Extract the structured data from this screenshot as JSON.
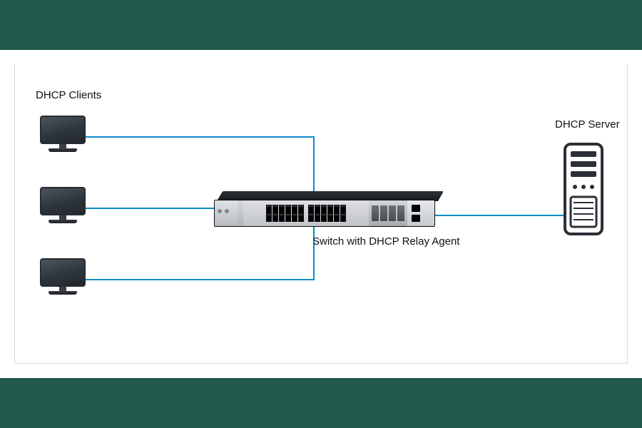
{
  "labels": {
    "clients": "DHCP Clients",
    "switch": "Switch with DHCP Relay Agent",
    "server": "DHCP Server"
  },
  "colors": {
    "band": "#1f5a4d",
    "wire": "#0b8cc6",
    "border": "#d7dadd"
  },
  "diagram": {
    "clients_count": 3,
    "switch_ports": 24,
    "sfp_slots": 4
  }
}
